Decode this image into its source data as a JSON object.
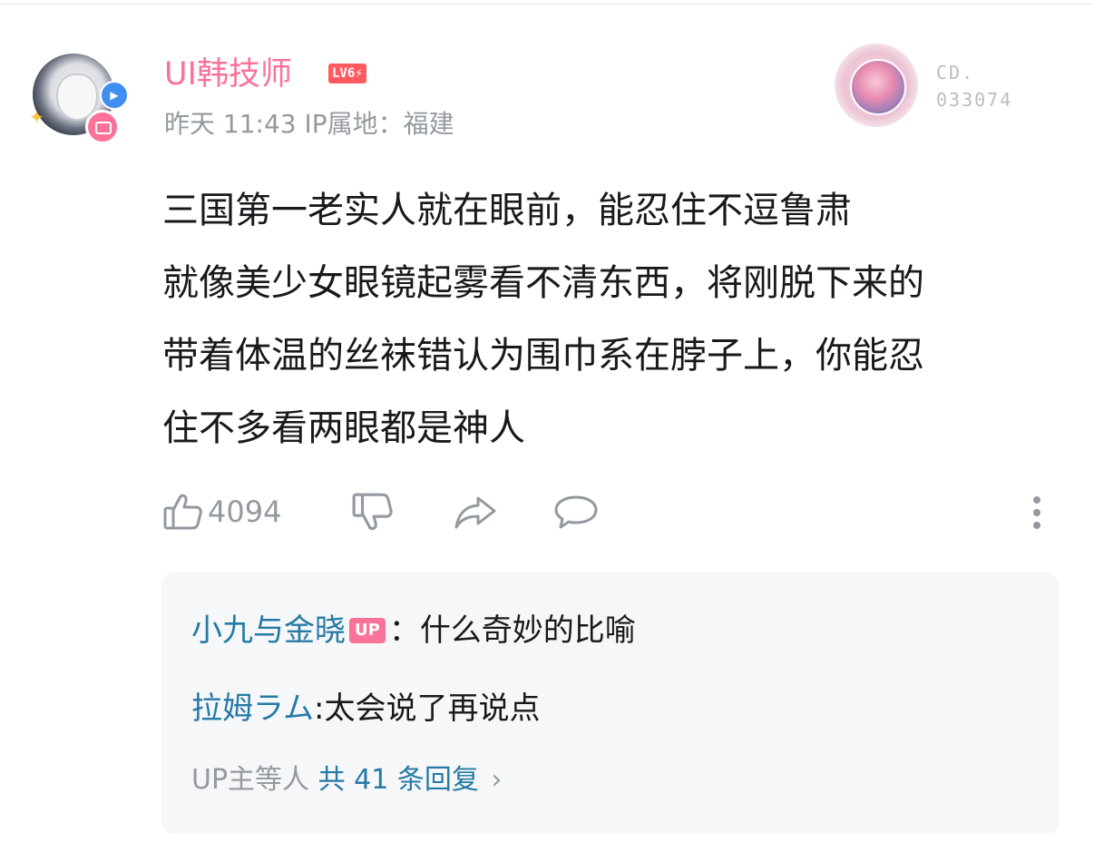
{
  "comment": {
    "user": {
      "name": "UI韩技师",
      "level": "LV6⚡",
      "time": "昨天 11:43",
      "ip_location": "IP属地：福建"
    },
    "fan_medal": {
      "code_top": "CD.",
      "code_bottom": "033074"
    },
    "text_lines": [
      "三国第一老实人就在眼前，能忍住不逗鲁肃",
      "就像美少女眼镜起雾看不清东西，将刚脱下来的",
      "带着体温的丝袜错认为围巾系在脖子上，你能忍",
      "住不多看两眼都是神人"
    ],
    "actions": {
      "like_count": "4094"
    },
    "replies": [
      {
        "name": "小九与金晓",
        "up_tag": "UP",
        "separator": "：",
        "text": "什么奇妙的比喻"
      },
      {
        "name": "拉姆ラム",
        "up_tag": "",
        "separator": ":",
        "text": "太会说了再说点"
      }
    ],
    "more_replies": {
      "prefix": "UP主等人",
      "count_text": "共 41 条回复",
      "chevron": "›"
    }
  },
  "icons": [
    "avatar",
    "level-badge-icon",
    "fan-medal-icon",
    "thumbs-up-icon",
    "thumbs-down-icon",
    "share-icon",
    "reply-icon",
    "more-vertical-icon"
  ],
  "colors": {
    "username": "#fb7299",
    "reply_name": "#257aa6",
    "meta": "#9499a0",
    "reply_bg": "#f6f7f8"
  }
}
